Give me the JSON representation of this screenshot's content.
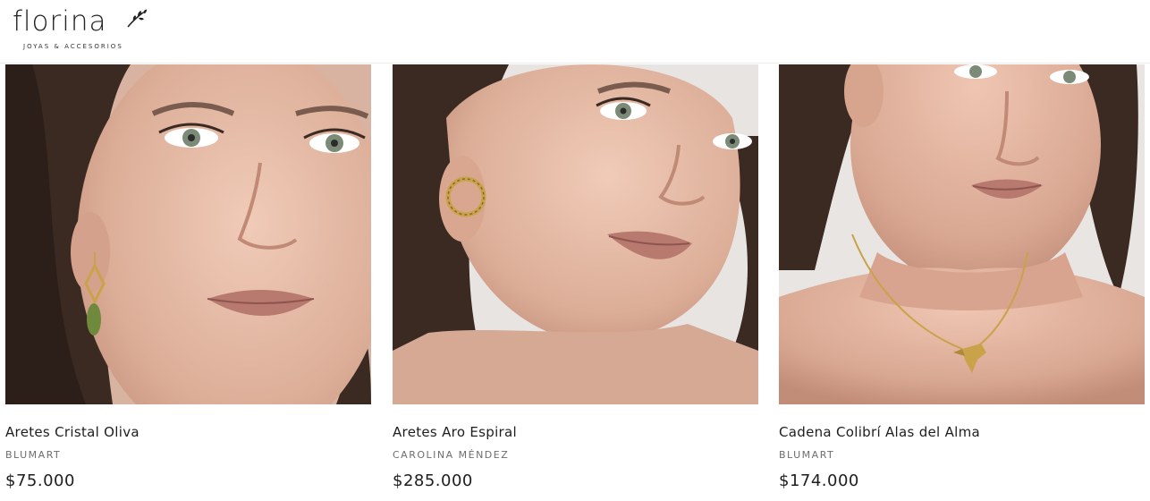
{
  "header": {
    "logo_word": "florina",
    "logo_tagline": "JOYAS & ACCESORIOS"
  },
  "products": [
    {
      "name": "Aretes Cristal Oliva",
      "brand": "BLUMART",
      "price": "$75.000"
    },
    {
      "name": "Aretes Aro Espiral",
      "brand": "CAROLINA MÉNDEZ",
      "price": "$285.000"
    },
    {
      "name": "Cadena Colibrí Alas del Alma",
      "brand": "BLUMART",
      "price": "$174.000"
    }
  ],
  "colors": {
    "skin": "#e3b7a4",
    "hair": "#3b2a22",
    "gold": "#c9a24a",
    "text": "#1e1e1e",
    "muted": "#6e6e6e"
  }
}
